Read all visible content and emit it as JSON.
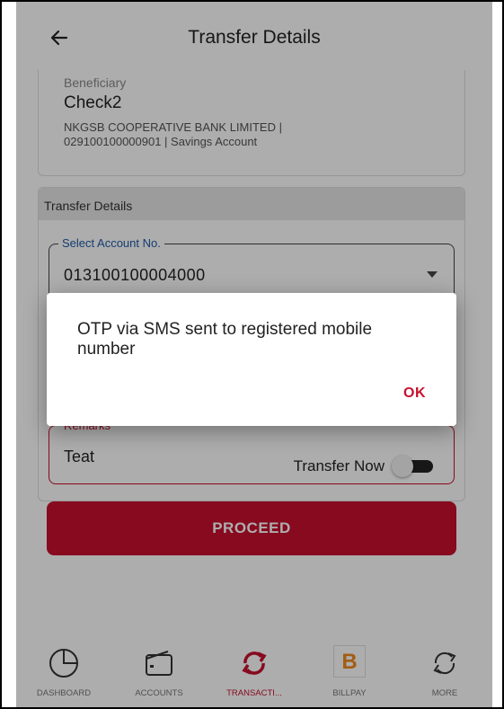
{
  "header": {
    "title": "Transfer Details",
    "back_icon": "arrow-left-icon"
  },
  "beneficiary": {
    "label": "Beneficiary",
    "name": "Check2",
    "details_line1": "NKGSB COOPERATIVE BANK LIMITED |",
    "details_line2": "029100100000901 | Savings Account"
  },
  "transfer_details": {
    "section_title": "Transfer Details",
    "account_label": "Select Account No.",
    "account_value": "013100100004000",
    "remarks_label": "Remarks",
    "remarks_value": "Teat"
  },
  "transfer_now": {
    "label": "Transfer Now",
    "enabled": false
  },
  "proceed": {
    "label": "PROCEED"
  },
  "dialog": {
    "message": "OTP via SMS sent to registered mobile number",
    "ok_label": "OK"
  },
  "bottom_nav": {
    "items": [
      {
        "label": "DASHBOARD",
        "icon": "dashboard-icon",
        "active": false
      },
      {
        "label": "ACCOUNTS",
        "icon": "wallet-icon",
        "active": false
      },
      {
        "label": "TRANSACTI...",
        "icon": "transfer-arrows-icon",
        "active": true
      },
      {
        "label": "BILLPAY",
        "icon": "billpay-logo-icon",
        "active": false,
        "logo_letter": "B"
      },
      {
        "label": "MORE",
        "icon": "refresh-arrows-icon",
        "active": false
      }
    ]
  },
  "colors": {
    "accent": "#c8102e",
    "field_label_blue": "#1e5aa8",
    "billpay_orange": "#f08a1c"
  }
}
